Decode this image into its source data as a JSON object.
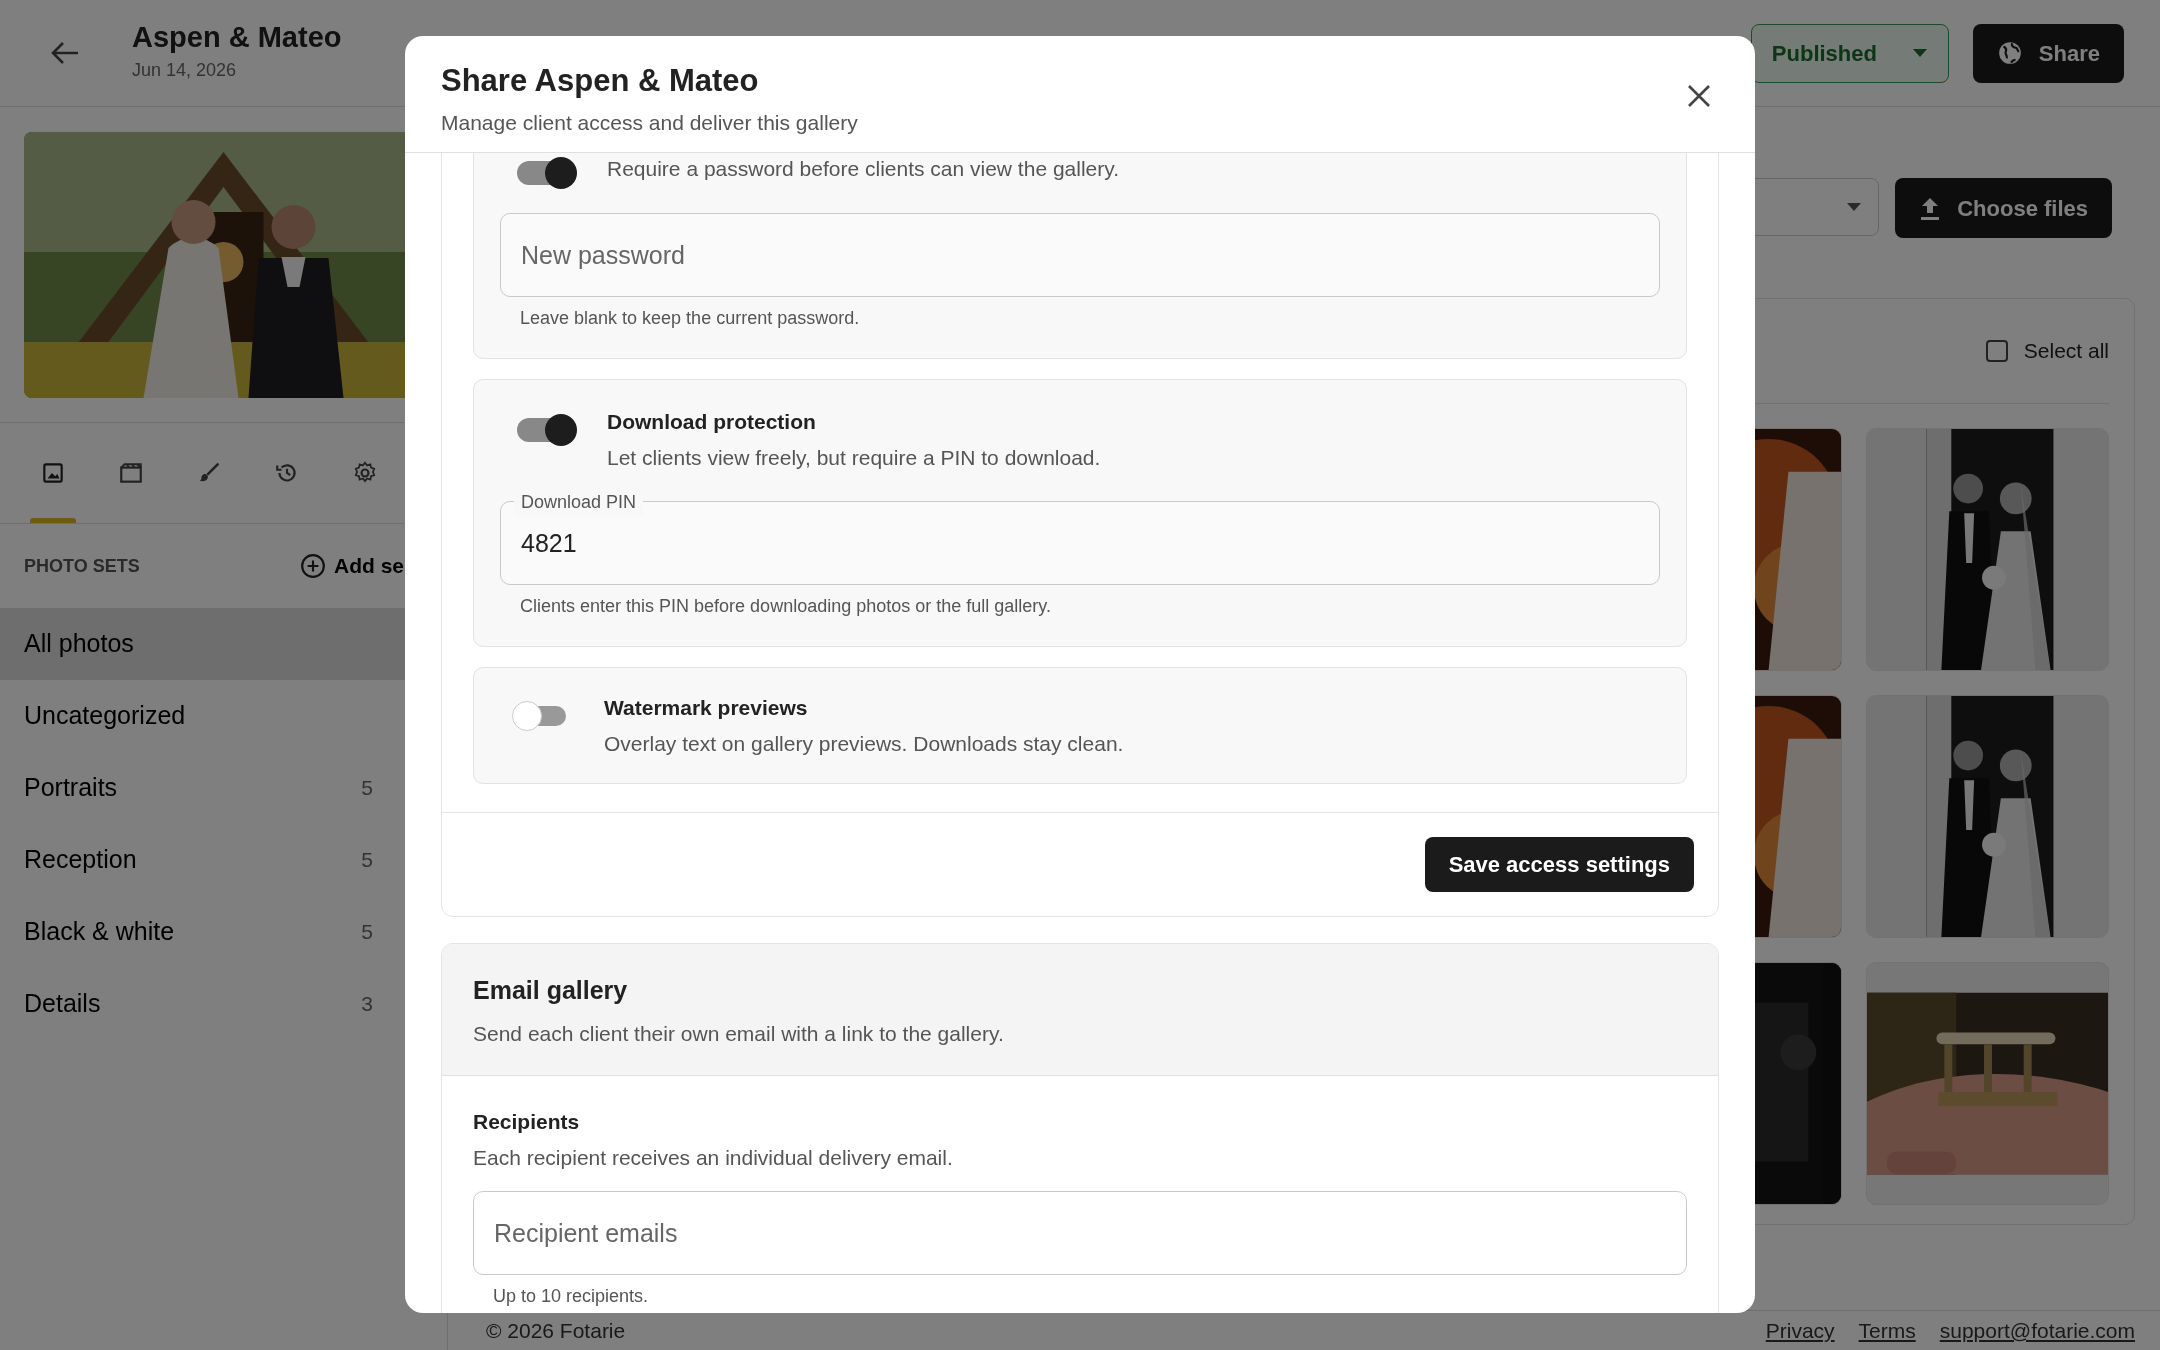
{
  "header": {
    "title": "Aspen & Mateo",
    "date": "Jun 14, 2026",
    "status": "Published",
    "share_button": "Share"
  },
  "sidebar": {
    "tabs": [
      {
        "kind": "photos",
        "selected": true
      },
      {
        "kind": "video",
        "selected": false
      },
      {
        "kind": "brush",
        "selected": false
      },
      {
        "kind": "history",
        "selected": false
      },
      {
        "kind": "settings",
        "selected": false
      }
    ],
    "section_label": "PHOTO SETS",
    "add_button": "Add se",
    "sets": [
      {
        "name": "All photos",
        "selected": true
      },
      {
        "name": "Uncategorized",
        "selected": false
      },
      {
        "name": "Portraits",
        "count": "5",
        "selected": false
      },
      {
        "name": "Reception",
        "count": "5",
        "selected": false
      },
      {
        "name": "Black & white",
        "count": "5",
        "selected": false
      },
      {
        "name": "Details",
        "count": "3",
        "selected": false
      }
    ]
  },
  "main": {
    "upload_button": "Choose files",
    "select_all": {
      "label": "Select all",
      "checked": false
    }
  },
  "footer": {
    "copyright": "© 2026 Fotarie",
    "links": [
      "Privacy",
      "Terms",
      "support@fotarie.com"
    ]
  },
  "modal": {
    "title": "Share Aspen & Mateo",
    "subtitle": "Manage client access and deliver this gallery",
    "access_sections": [
      {
        "on": true,
        "description": "Require a password before clients can view the gallery.",
        "field": {
          "placeholder": "New password"
        },
        "hint": "Leave blank to keep the current password."
      },
      {
        "title": "Download protection",
        "on": true,
        "description": "Let clients view freely, but require a PIN to download.",
        "field": {
          "label": "Download PIN",
          "value": "4821"
        },
        "hint": "Clients enter this PIN before downloading photos or the full gallery."
      },
      {
        "title": "Watermark previews",
        "on": false,
        "description": "Overlay text on gallery previews. Downloads stay clean."
      }
    ],
    "save_button": "Save access settings",
    "email": {
      "title": "Email gallery",
      "description": "Send each client their own email with a link to the gallery.",
      "recipients_title": "Recipients",
      "recipients_description": "Each recipient receives an individual delivery email.",
      "field": {
        "placeholder": "Recipient emails"
      },
      "hint": "Up to 10 recipients."
    }
  }
}
